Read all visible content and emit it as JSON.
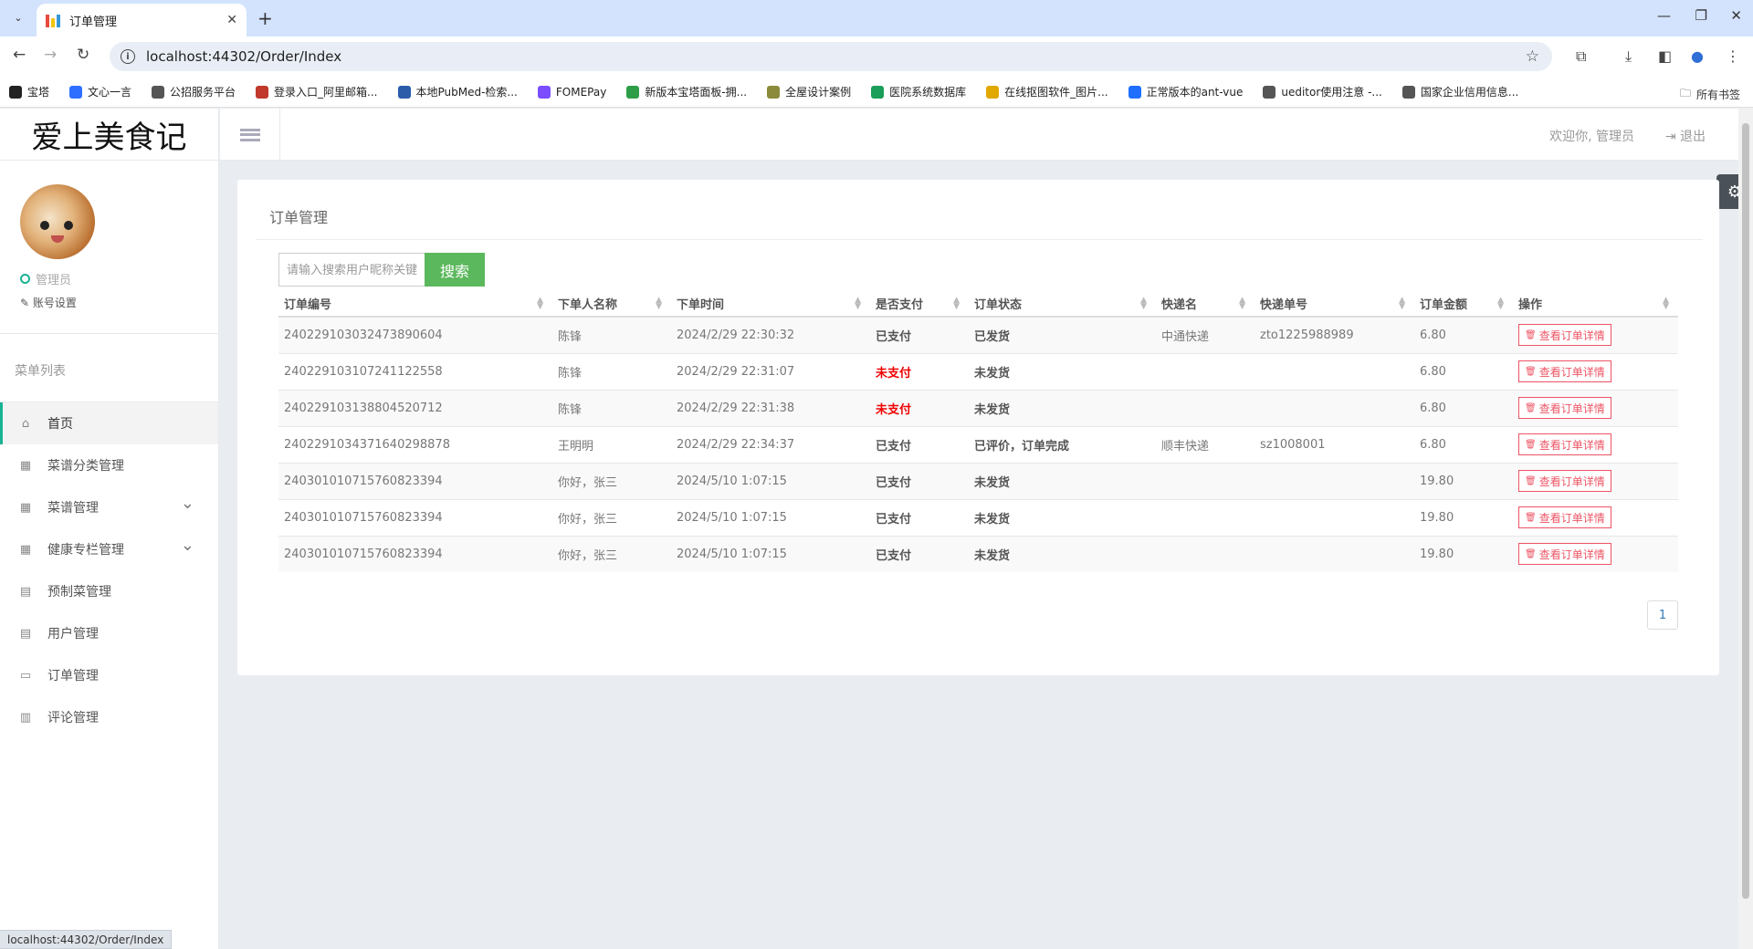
{
  "browser": {
    "tab_title": "订单管理",
    "url": "localhost:44302/Order/Index",
    "bookmarks": [
      {
        "label": "宝塔",
        "icon": "bt-icon",
        "color": "#222"
      },
      {
        "label": "文心一言",
        "icon": "wenxin-icon",
        "color": "#2f6fff"
      },
      {
        "label": "公招服务平台",
        "icon": "globe-icon",
        "color": "#555"
      },
      {
        "label": "登录入口_阿里邮箱...",
        "icon": "mail-icon",
        "color": "#c0392b"
      },
      {
        "label": "本地PubMed-检索...",
        "icon": "search-icon",
        "color": "#2a5caa"
      },
      {
        "label": "FOMEPay",
        "icon": "fomepay-icon",
        "color": "#7b4dff"
      },
      {
        "label": "新版本宝塔面板-拥...",
        "icon": "shield-icon",
        "color": "#2e9d47"
      },
      {
        "label": "全屋设计案例",
        "icon": "layers-icon",
        "color": "#8a8a3a"
      },
      {
        "label": "医院系统数据库",
        "icon": "s-icon",
        "color": "#1b9e5a"
      },
      {
        "label": "在线抠图软件_图片...",
        "icon": "cap-icon",
        "color": "#e0a800"
      },
      {
        "label": "正常版本的ant-vue",
        "icon": "vue-icon",
        "color": "#1e6fff"
      },
      {
        "label": "ueditor使用注意 -...",
        "icon": "link-icon",
        "color": "#555"
      },
      {
        "label": "国家企业信用信息...",
        "icon": "globe-icon",
        "color": "#555"
      }
    ],
    "all_bookmarks": "所有书签",
    "status_url": "localhost:44302/Order/Index"
  },
  "sidebar": {
    "logo": "爱上美食记",
    "role": "管理员",
    "account_settings": "账号设置",
    "menu_title": "菜单列表",
    "items": [
      {
        "label": "首页",
        "icon": "home-icon",
        "glyph": "⌂",
        "active": true,
        "expandable": false
      },
      {
        "label": "菜谱分类管理",
        "icon": "table-icon",
        "glyph": "▦",
        "active": false,
        "expandable": false
      },
      {
        "label": "菜谱管理",
        "icon": "table-icon",
        "glyph": "▦",
        "active": false,
        "expandable": true
      },
      {
        "label": "健康专栏管理",
        "icon": "table-icon",
        "glyph": "▦",
        "active": false,
        "expandable": true
      },
      {
        "label": "预制菜管理",
        "icon": "calendar-icon",
        "glyph": "▤",
        "active": false,
        "expandable": false
      },
      {
        "label": "用户管理",
        "icon": "calendar-icon",
        "glyph": "▤",
        "active": false,
        "expandable": false
      },
      {
        "label": "订单管理",
        "icon": "list-icon",
        "glyph": "▭",
        "active": false,
        "expandable": false
      },
      {
        "label": "评论管理",
        "icon": "bar-chart-icon",
        "glyph": "▥",
        "active": false,
        "expandable": false
      }
    ]
  },
  "topbar": {
    "welcome": "欢迎你, 管理员",
    "logout": "退出"
  },
  "panel": {
    "title": "订单管理",
    "search_placeholder": "请输入搜索用户昵称关键字",
    "search_button": "搜索",
    "columns": [
      "订单编号",
      "下单人名称",
      "下单时间",
      "是否支付",
      "订单状态",
      "快递名",
      "快递单号",
      "订单金额",
      "操作"
    ],
    "rows": [
      {
        "id": "2402291030324738906​04",
        "user": "陈锋",
        "time": "2024/2/29 22:30:32",
        "paid": "已支付",
        "paid_flag": true,
        "status": "已发货",
        "courier": "中通快递",
        "tracking": "zto1225988989",
        "amount": "6.80"
      },
      {
        "id": "240229103107241122558",
        "user": "陈锋",
        "time": "2024/2/29 22:31:07",
        "paid": "未支付",
        "paid_flag": false,
        "status": "未发货",
        "courier": "",
        "tracking": "",
        "amount": "6.80"
      },
      {
        "id": "240229103138804520712",
        "user": "陈锋",
        "time": "2024/2/29 22:31:38",
        "paid": "未支付",
        "paid_flag": false,
        "status": "未发货",
        "courier": "",
        "tracking": "",
        "amount": "6.80"
      },
      {
        "id": "240229103437164029887​8",
        "user": "王明明",
        "time": "2024/2/29 22:34:37",
        "paid": "已支付",
        "paid_flag": true,
        "status": "已评价，订单完成",
        "courier": "顺丰快递",
        "tracking": "sz1008001",
        "amount": "6.80"
      },
      {
        "id": "240301010715760823394",
        "user": "你好，张三",
        "time": "2024/5/10 1:07:15",
        "paid": "已支付",
        "paid_flag": true,
        "status": "未发货",
        "courier": "",
        "tracking": "",
        "amount": "19.80"
      },
      {
        "id": "240301010715760823394",
        "user": "你好，张三",
        "time": "2024/5/10 1:07:15",
        "paid": "已支付",
        "paid_flag": true,
        "status": "未发货",
        "courier": "",
        "tracking": "",
        "amount": "19.80"
      },
      {
        "id": "240301010715760823394",
        "user": "你好，张三",
        "time": "2024/5/10 1:07:15",
        "paid": "已支付",
        "paid_flag": true,
        "status": "未发货",
        "courier": "",
        "tracking": "",
        "amount": "19.80"
      }
    ],
    "detail_label": "查看订单详情",
    "page": "1"
  }
}
